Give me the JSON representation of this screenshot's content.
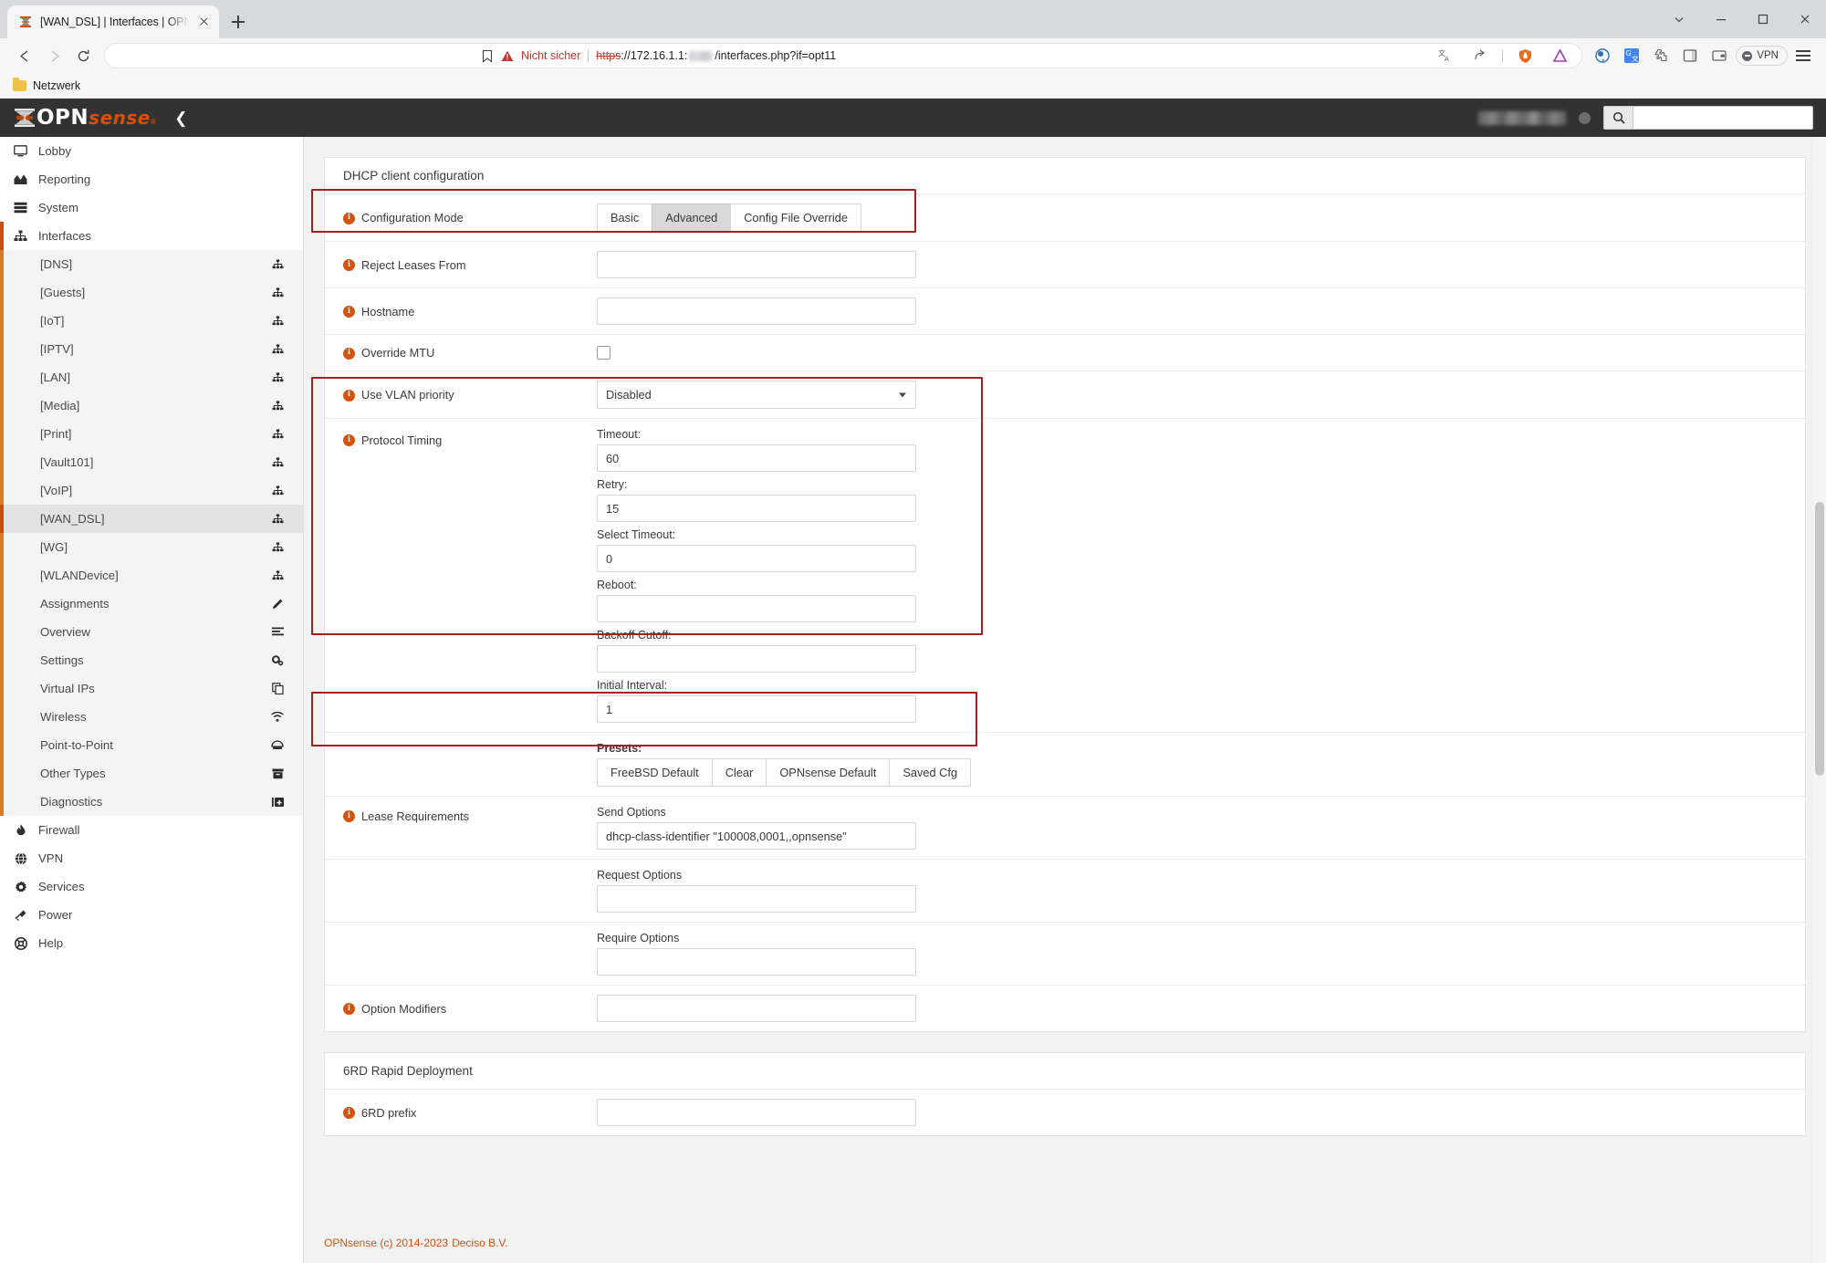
{
  "browser": {
    "tab": {
      "title": "[WAN_DSL] | Interfaces | OPNsens",
      "favicon_name": "opnsense-favicon"
    },
    "newtab_label": "+",
    "nav": {
      "back": "Back",
      "forward": "Forward",
      "reload": "Reload"
    },
    "omnibox": {
      "security_label": "Nicht sicher",
      "scheme": "https",
      "scheme_sep": "://",
      "host": "172.16.1.1:",
      "path": "/interfaces.php?if=opt11"
    },
    "vpn_label": "VPN",
    "bookmarks": [
      {
        "label": "Netzwerk",
        "icon": "folder-icon"
      }
    ]
  },
  "header": {
    "logo_o": "OPN",
    "logo_sense": "sense",
    "logo_reg": "®",
    "collapse_icon": "chevron-left-icon",
    "search_placeholder": "",
    "search_value": ""
  },
  "sidebar": {
    "top_items": [
      {
        "label": "Lobby",
        "icon": "desktop-icon"
      },
      {
        "label": "Reporting",
        "icon": "chart-area-icon"
      },
      {
        "label": "System",
        "icon": "server-icon"
      },
      {
        "label": "Interfaces",
        "icon": "sitemap-icon",
        "active": true
      }
    ],
    "interface_children": [
      {
        "label": "[DNS]",
        "icon": "sitemap-icon"
      },
      {
        "label": "[Guests]",
        "icon": "sitemap-icon"
      },
      {
        "label": "[IoT]",
        "icon": "sitemap-icon"
      },
      {
        "label": "[IPTV]",
        "icon": "sitemap-icon"
      },
      {
        "label": "[LAN]",
        "icon": "sitemap-icon"
      },
      {
        "label": "[Media]",
        "icon": "sitemap-icon"
      },
      {
        "label": "[Print]",
        "icon": "sitemap-icon"
      },
      {
        "label": "[Vault101]",
        "icon": "sitemap-icon"
      },
      {
        "label": "[VoIP]",
        "icon": "sitemap-icon"
      },
      {
        "label": "[WAN_DSL]",
        "icon": "sitemap-icon",
        "selected": true
      },
      {
        "label": "[WG]",
        "icon": "sitemap-icon"
      },
      {
        "label": "[WLANDevice]",
        "icon": "sitemap-icon"
      },
      {
        "label": "Assignments",
        "icon": "pencil-icon"
      },
      {
        "label": "Overview",
        "icon": "list-icon"
      },
      {
        "label": "Settings",
        "icon": "gears-icon"
      },
      {
        "label": "Virtual IPs",
        "icon": "copy-icon"
      },
      {
        "label": "Wireless",
        "icon": "wifi-icon"
      },
      {
        "label": "Point-to-Point",
        "icon": "modem-icon"
      },
      {
        "label": "Other Types",
        "icon": "archive-icon"
      },
      {
        "label": "Diagnostics",
        "icon": "medkit-icon"
      }
    ],
    "bottom_items": [
      {
        "label": "Firewall",
        "icon": "fire-icon"
      },
      {
        "label": "VPN",
        "icon": "globe-icon"
      },
      {
        "label": "Services",
        "icon": "cog-icon"
      },
      {
        "label": "Power",
        "icon": "power-plug-icon"
      },
      {
        "label": "Help",
        "icon": "lifebuoy-icon"
      }
    ]
  },
  "main": {
    "panel_title": "DHCP client configuration",
    "config_mode": {
      "label": "Configuration Mode",
      "options": [
        "Basic",
        "Advanced",
        "Config File Override"
      ],
      "selected": "Advanced"
    },
    "reject_leases": {
      "label": "Reject Leases From",
      "value": ""
    },
    "hostname": {
      "label": "Hostname",
      "value": ""
    },
    "override_mtu": {
      "label": "Override MTU",
      "checked": false
    },
    "vlan_priority": {
      "label": "Use VLAN priority",
      "value": "Disabled"
    },
    "protocol_timing": {
      "label": "Protocol Timing",
      "fields": [
        {
          "label": "Timeout:",
          "value": "60"
        },
        {
          "label": "Retry:",
          "value": "15"
        },
        {
          "label": "Select Timeout:",
          "value": "0"
        },
        {
          "label": "Reboot:",
          "value": ""
        },
        {
          "label": "Backoff Cutoff:",
          "value": ""
        },
        {
          "label": "Initial Interval:",
          "value": "1"
        }
      ]
    },
    "presets": {
      "label": "Presets:",
      "buttons": [
        "FreeBSD Default",
        "Clear",
        "OPNsense Default",
        "Saved Cfg"
      ]
    },
    "lease_requirements": {
      "label": "Lease Requirements",
      "send_options": {
        "label": "Send Options",
        "value": "dhcp-class-identifier \"100008,0001,,opnsense\""
      },
      "request_options": {
        "label": "Request Options",
        "value": ""
      },
      "require_options": {
        "label": "Require Options",
        "value": ""
      }
    },
    "option_modifiers": {
      "label": "Option Modifiers",
      "value": ""
    },
    "sixrd": {
      "panel_title": "6RD Rapid Deployment",
      "prefix_label": "6RD prefix",
      "prefix_value": ""
    }
  },
  "footer": {
    "copyright": "OPNsense (c) 2014-2023",
    "vendor": "Deciso B.V."
  },
  "colors": {
    "accent_orange": "#d25410",
    "highlight_red": "#a61f20",
    "header_dark": "#323232"
  }
}
